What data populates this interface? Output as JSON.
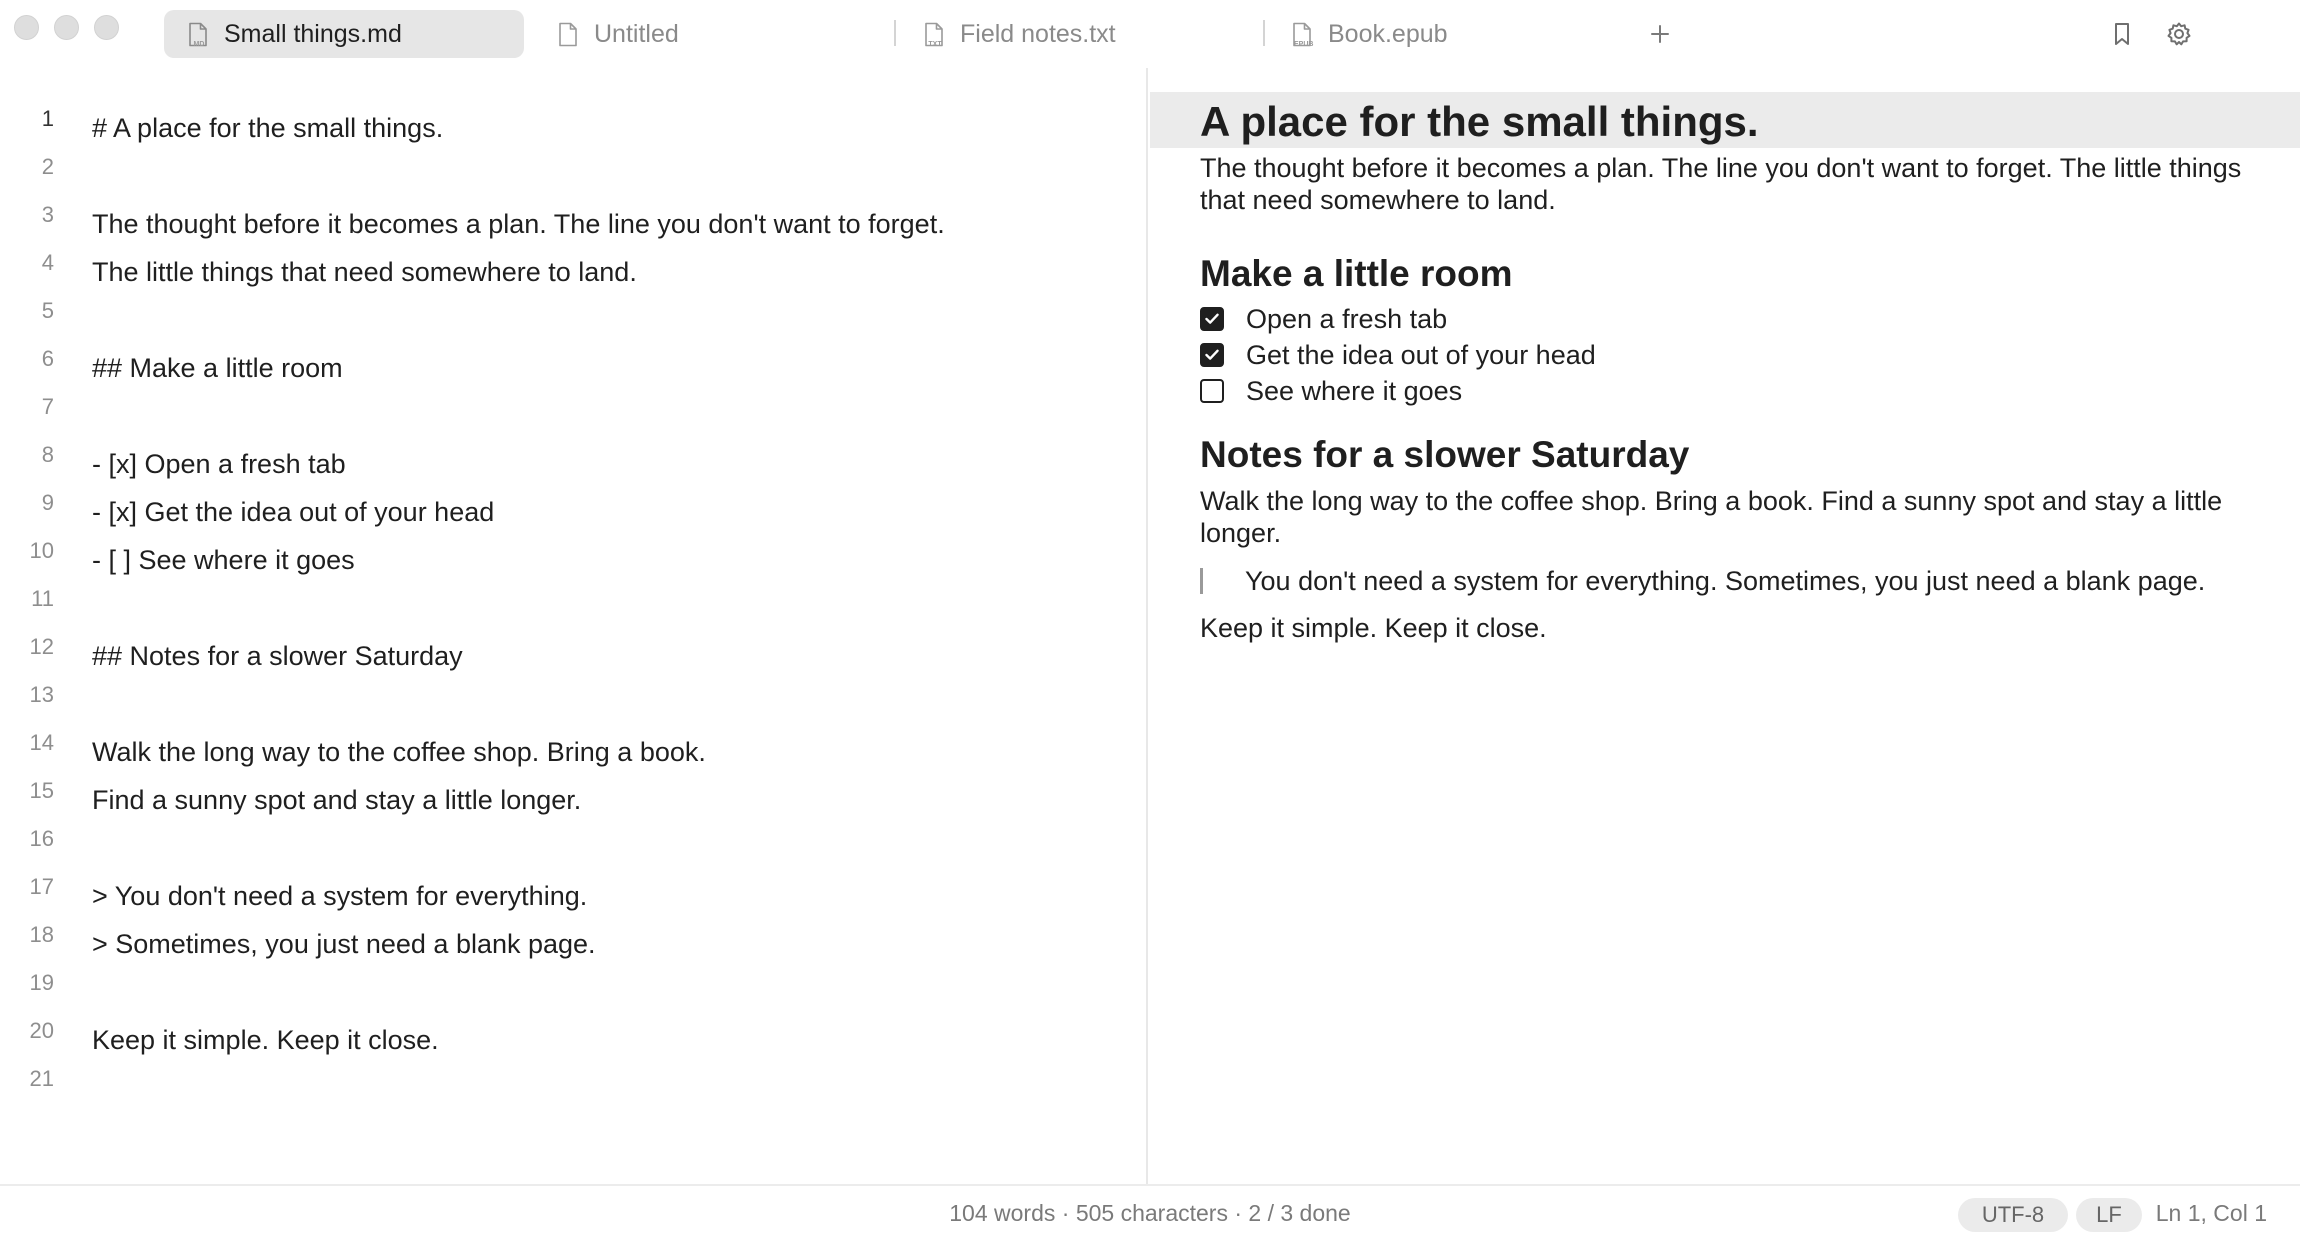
{
  "tabs": [
    {
      "label": "Small things.md",
      "ext": "MD",
      "active": true
    },
    {
      "label": "Untitled",
      "ext": "",
      "active": false
    },
    {
      "label": "Field notes.txt",
      "ext": "TXT",
      "active": false
    },
    {
      "label": "Book.epub",
      "ext": "EPUB",
      "active": false
    }
  ],
  "toolbar": {
    "new_tab_icon": "plus-icon",
    "bookmark_icon": "bookmark-icon",
    "settings_icon": "gear-icon"
  },
  "editor": {
    "current_line": "1",
    "lines": [
      {
        "n": "1",
        "text": "# A place for the small things."
      },
      {
        "n": "2",
        "text": ""
      },
      {
        "n": "3",
        "text": "The thought before it becomes a plan. The line you don't want to forget."
      },
      {
        "n": "4",
        "text": "The little things that need somewhere to land."
      },
      {
        "n": "5",
        "text": ""
      },
      {
        "n": "6",
        "text": "## Make a little room"
      },
      {
        "n": "7",
        "text": ""
      },
      {
        "n": "8",
        "text": "- [x] Open a fresh tab"
      },
      {
        "n": "9",
        "text": "- [x] Get the idea out of your head"
      },
      {
        "n": "10",
        "text": "- [ ] See where it goes"
      },
      {
        "n": "11",
        "text": ""
      },
      {
        "n": "12",
        "text": "## Notes for a slower Saturday"
      },
      {
        "n": "13",
        "text": ""
      },
      {
        "n": "14",
        "text": "Walk the long way to the coffee shop. Bring a book."
      },
      {
        "n": "15",
        "text": "Find a sunny spot and stay a little longer."
      },
      {
        "n": "16",
        "text": ""
      },
      {
        "n": "17",
        "text": "> You don't need a system for everything."
      },
      {
        "n": "18",
        "text": "> Sometimes, you just need a blank page."
      },
      {
        "n": "19",
        "text": ""
      },
      {
        "n": "20",
        "text": "Keep it simple. Keep it close."
      },
      {
        "n": "21",
        "text": ""
      }
    ]
  },
  "preview": {
    "h1": "A place for the small things.",
    "intro": "The thought before it becomes a plan. The line you don't want to forget. The little things that need somewhere to land.",
    "section1": {
      "heading": "Make a little room",
      "tasks": [
        {
          "label": "Open a fresh tab",
          "done": true
        },
        {
          "label": "Get the idea out of your head",
          "done": true
        },
        {
          "label": "See where it goes",
          "done": false
        }
      ]
    },
    "section2": {
      "heading": "Notes for a slower Saturday",
      "paragraph": "Walk the long way to the coffee shop. Bring a book. Find a sunny spot and stay a little longer.",
      "quote": "You don't need a system for everything. Sometimes, you just need a blank page.",
      "closing": "Keep it simple. Keep it close."
    }
  },
  "status": {
    "summary": "104 words · 505 characters · 2 / 3 done",
    "encoding": "UTF-8",
    "line_ending": "LF",
    "cursor": "Ln 1, Col 1"
  }
}
